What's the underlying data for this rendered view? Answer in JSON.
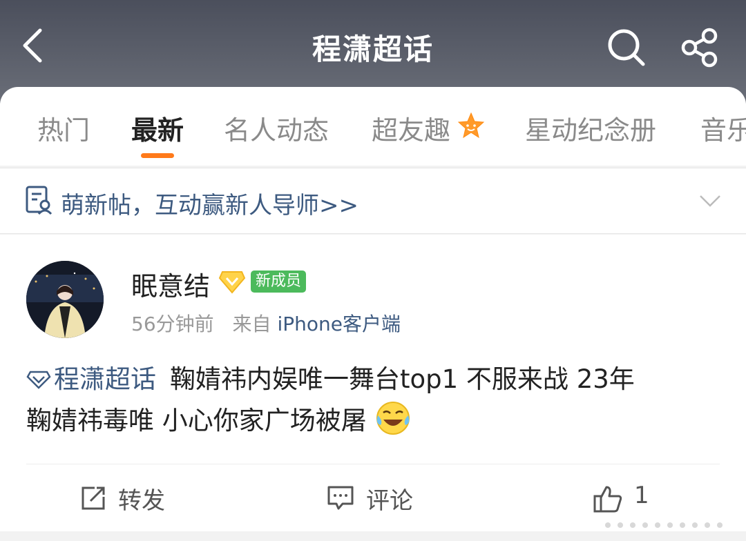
{
  "header": {
    "title": "程潇超话",
    "back_icon": "chevron-left-icon",
    "search_icon": "search-icon",
    "share_icon": "share-icon"
  },
  "tabs": [
    {
      "label": "热门",
      "active": false
    },
    {
      "label": "最新",
      "active": true
    },
    {
      "label": "名人动态",
      "active": false
    },
    {
      "label": "超友趣",
      "active": false
    },
    {
      "label": "星动纪念册",
      "active": false
    },
    {
      "label": "音乐",
      "active": false
    }
  ],
  "notice": {
    "text": "萌新帖，互动赢新人导师>>"
  },
  "post": {
    "author": "眠意结",
    "member_badge": "新成员",
    "time": "56分钟前",
    "source_prefix": "来自",
    "source": "iPhone客户端",
    "topic": "程潇超话",
    "text_line1": "鞠婧祎内娱唯一舞台top1 不服来战 23年",
    "text_line2": "鞠婧祎毒唯 小心你家广场被屠"
  },
  "actions": {
    "repost": "转发",
    "comment": "评论",
    "like_count": "1"
  },
  "colors": {
    "accent": "#ff7a1a",
    "link": "#3d5a80",
    "badge_green": "#4cba5c"
  }
}
